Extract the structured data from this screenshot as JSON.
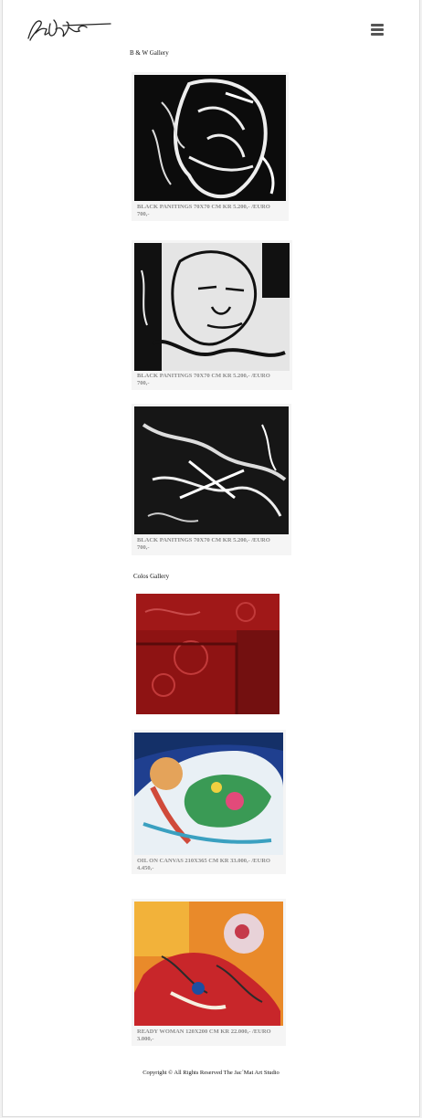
{
  "header": {
    "logo_icon": "signature-logo",
    "menu_icon": "hamburger-menu-icon"
  },
  "sections": {
    "bw_title": "B & W Gallery",
    "color_title": "Colos Gallery"
  },
  "bw_items": [
    {
      "caption": "BLACK PANITINGS 70X70 CM KR 5.200,- /EURO 700,-"
    },
    {
      "caption": "BLACK PANITINGS 70X70 CM KR 5.200,- /EURO 700,-"
    },
    {
      "caption": "BLACK PANITINGS 70X70 CM KR 5.200,- /EURO 700,-"
    }
  ],
  "color_items": [
    {
      "caption": ""
    },
    {
      "caption": "OIL ON CANVAS 210x365 cm KR 33.000,- /EURO 4.450,-"
    },
    {
      "caption": "READY WOMAN 120X200 CM KR 22.000,- /EURO 3.000,-"
    }
  ],
  "footer": {
    "text": "Copyright ©  All Rights Reserved The Jac´Mat Art Studio"
  },
  "colors": {
    "caption_gray": "#8a8a8a",
    "card_bg": "#f5f5f5"
  }
}
